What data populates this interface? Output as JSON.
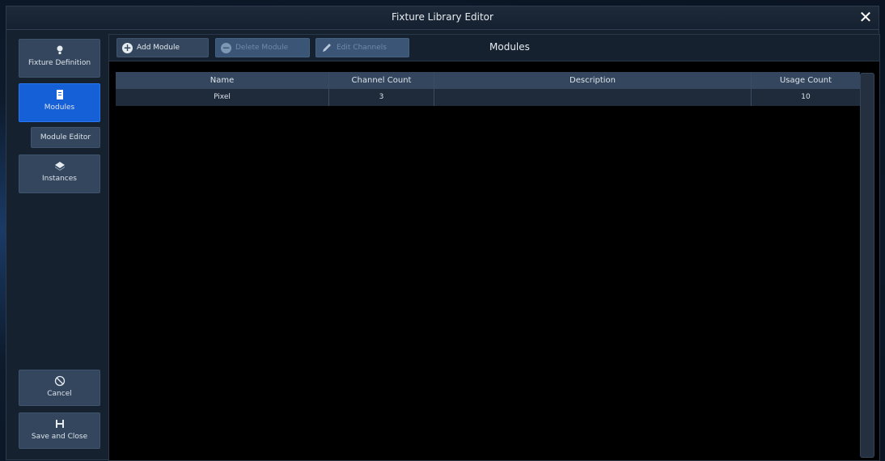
{
  "window": {
    "title": "Fixture Library Editor"
  },
  "sidebar": {
    "items": [
      {
        "label": "Fixture Definition",
        "icon": "lightbulb-icon"
      },
      {
        "label": "Modules",
        "icon": "document-icon",
        "active": true
      },
      {
        "label": "Module Editor"
      },
      {
        "label": "Instances",
        "icon": "stack-icon"
      }
    ],
    "cancel_label": "Cancel",
    "save_label": "Save and Close"
  },
  "toolbar": {
    "add_label": "Add Module",
    "delete_label": "Delete Module",
    "edit_label": "Edit Channels"
  },
  "panel": {
    "title": "Modules"
  },
  "table": {
    "columns": [
      "Name",
      "Channel Count",
      "Description",
      "Usage Count"
    ],
    "rows": [
      [
        "Pixel",
        "3",
        "",
        "10"
      ]
    ]
  },
  "colors": {
    "accent": "#1560d6",
    "button": "#33465d",
    "background": "#000000"
  }
}
